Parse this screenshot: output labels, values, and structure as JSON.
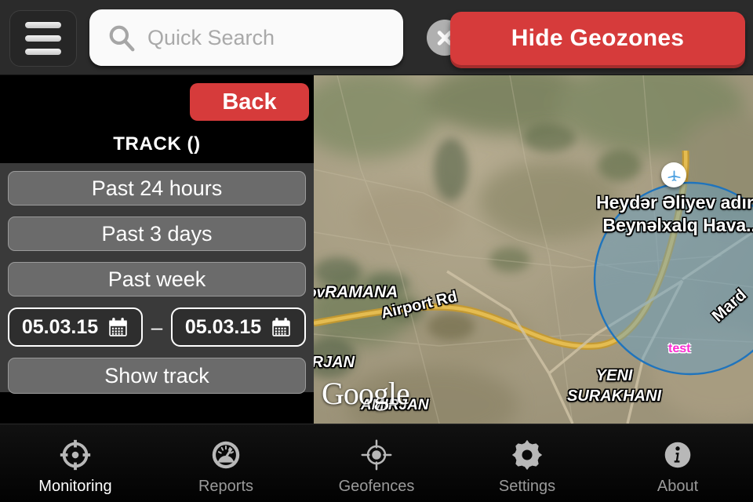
{
  "topbar": {
    "menu_icon": "hamburger-menu-icon",
    "search": {
      "icon": "search-icon",
      "value": "",
      "placeholder": "Quick Search",
      "clear_icon": "clear-x-icon"
    },
    "geozone_button_label": "Hide Geozones",
    "accent_red": "#d63b3b"
  },
  "panel": {
    "back_label": "Back",
    "title": "TRACK ()",
    "range_buttons": [
      {
        "label": "Past 24 hours"
      },
      {
        "label": "Past 3 days"
      },
      {
        "label": "Past week"
      }
    ],
    "date_from": "05.03.15",
    "date_to": "05.03.15",
    "date_separator": "–",
    "calendar_icon": "calendar-icon",
    "show_track_label": "Show track"
  },
  "map": {
    "provider_watermark": "Google",
    "geozone": {
      "name": "test",
      "color": "#ff2ad4",
      "fill": "#4a90c8",
      "stroke": "#1a6fb5"
    },
    "marker_icon": "airplane-marker-icon",
    "labels": {
      "airport_line1": "Heydər Əliyev adına",
      "airport_line2": "Beynəlxalq Hava...",
      "ramana_prefix": "ov",
      "ramana": "RAMANA",
      "airport_rd": "Airport Rd",
      "irjan": "IRJAN",
      "amirjan": "AMIRJAN",
      "yeni_line1": "YENI",
      "yeni_line2": "SURAKHANI",
      "mardakan": "Mard"
    }
  },
  "tabbar": {
    "tabs": [
      {
        "label": "Monitoring",
        "icon": "crosshair-icon",
        "active": true
      },
      {
        "label": "Reports",
        "icon": "gauge-icon",
        "active": false
      },
      {
        "label": "Geofences",
        "icon": "target-locate-icon",
        "active": false
      },
      {
        "label": "Settings",
        "icon": "gear-icon",
        "active": false
      },
      {
        "label": "About",
        "icon": "info-circle-icon",
        "active": false
      }
    ]
  }
}
